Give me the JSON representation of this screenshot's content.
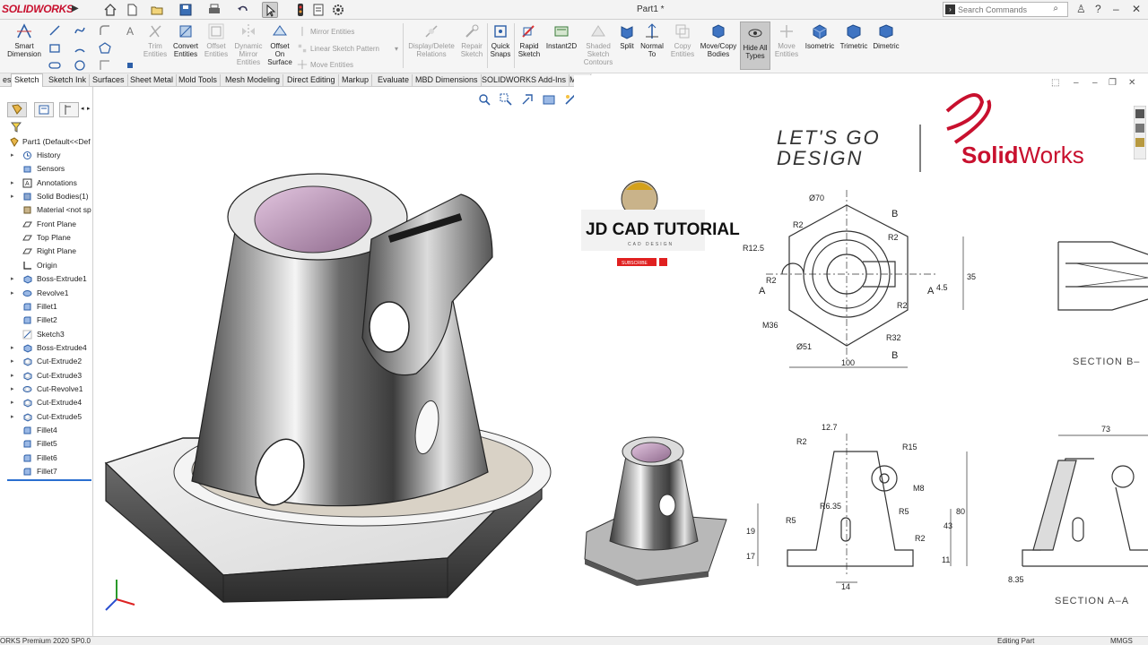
{
  "app": {
    "logo": "SOLIDWORKS",
    "document_title": "Part1 *"
  },
  "search": {
    "placeholder": "Search Commands"
  },
  "command_manager": {
    "items": [
      {
        "label": "Smart Dimension",
        "enabled": true,
        "icon": "smart-dimension-icon"
      },
      {
        "label": "Trim Entities",
        "enabled": false,
        "icon": "trim-icon"
      },
      {
        "label": "Convert Entities",
        "enabled": true,
        "icon": "convert-entities-icon"
      },
      {
        "label": "Offset Entities",
        "enabled": false,
        "icon": "offset-icon"
      },
      {
        "label": "Dynamic Mirror Entities",
        "enabled": false,
        "icon": "dynamic-mirror-icon"
      },
      {
        "label": "Offset On Surface",
        "enabled": true,
        "icon": "offset-surface-icon"
      },
      {
        "label": "Display/Delete Relations",
        "enabled": false,
        "icon": "relations-icon"
      },
      {
        "label": "Repair Sketch",
        "enabled": false,
        "icon": "repair-sketch-icon"
      },
      {
        "label": "Quick Snaps",
        "enabled": true,
        "icon": "quick-snaps-icon"
      },
      {
        "label": "Rapid Sketch",
        "enabled": true,
        "icon": "rapid-sketch-icon"
      },
      {
        "label": "Instant2D",
        "enabled": true,
        "icon": "instant2d-icon"
      },
      {
        "label": "Shaded Sketch Contours",
        "enabled": false,
        "icon": "shaded-sketch-icon"
      },
      {
        "label": "Split",
        "enabled": true,
        "icon": "split-icon"
      },
      {
        "label": "Normal To",
        "enabled": true,
        "icon": "normal-to-icon"
      },
      {
        "label": "Copy Entities",
        "enabled": false,
        "icon": "copy-entities-icon"
      },
      {
        "label": "Move/Copy Bodies",
        "enabled": true,
        "icon": "move-copy-icon"
      },
      {
        "label": "Hide All Types",
        "enabled": true,
        "icon": "hide-all-types-icon"
      },
      {
        "label": "Move Entities",
        "enabled": false,
        "icon": "move-entities-icon"
      },
      {
        "label": "Isometric",
        "enabled": true,
        "icon": "isometric-icon"
      },
      {
        "label": "Trimetric",
        "enabled": true,
        "icon": "trimetric-icon"
      },
      {
        "label": "Dimetric",
        "enabled": true,
        "icon": "dimetric-icon"
      }
    ],
    "small_items": {
      "mirror": "Mirror Entities",
      "linear_pattern": "Linear Sketch Pattern",
      "move": "Move Entities"
    }
  },
  "tabs": [
    "Features",
    "Sketch",
    "Sketch Ink",
    "Surfaces",
    "Sheet Metal",
    "Mold Tools",
    "Mesh Modeling",
    "Direct Editing",
    "Markup",
    "Evaluate",
    "MBD Dimensions",
    "SOLIDWORKS Add-Ins",
    "MBD"
  ],
  "tabs_visible": [
    "es",
    "Sketch",
    "Sketch Ink",
    "Surfaces",
    "Sheet Metal",
    "Mold Tools",
    "Mesh Modeling",
    "Direct Editing",
    "Markup",
    "Evaluate",
    "MBD Dimensions",
    "SOLIDWORKS Add-Ins",
    "MBD"
  ],
  "active_tab": "Sketch",
  "feature_tree": {
    "root": "Part1  (Default<<Def",
    "nodes": [
      {
        "label": "History",
        "expand": true,
        "icon": "history-icon"
      },
      {
        "label": "Sensors",
        "expand": false,
        "icon": "sensor-icon"
      },
      {
        "label": "Annotations",
        "expand": true,
        "icon": "annotation-icon"
      },
      {
        "label": "Solid Bodies(1)",
        "expand": true,
        "icon": "solid-bodies-icon"
      },
      {
        "label": "Material <not sp",
        "expand": false,
        "icon": "material-icon"
      },
      {
        "label": "Front Plane",
        "expand": false,
        "icon": "plane-icon"
      },
      {
        "label": "Top Plane",
        "expand": false,
        "icon": "plane-icon"
      },
      {
        "label": "Right Plane",
        "expand": false,
        "icon": "plane-icon"
      },
      {
        "label": "Origin",
        "expand": false,
        "icon": "origin-icon"
      },
      {
        "label": "Boss-Extrude1",
        "expand": true,
        "icon": "extrude-icon"
      },
      {
        "label": "Revolve1",
        "expand": true,
        "icon": "revolve-icon"
      },
      {
        "label": "Fillet1",
        "expand": false,
        "icon": "fillet-icon"
      },
      {
        "label": "Fillet2",
        "expand": false,
        "icon": "fillet-icon"
      },
      {
        "label": "Sketch3",
        "expand": false,
        "icon": "sketch-icon"
      },
      {
        "label": "Boss-Extrude4",
        "expand": true,
        "icon": "extrude-icon"
      },
      {
        "label": "Cut-Extrude2",
        "expand": true,
        "icon": "cut-extrude-icon"
      },
      {
        "label": "Cut-Extrude3",
        "expand": true,
        "icon": "cut-extrude-icon"
      },
      {
        "label": "Cut-Revolve1",
        "expand": true,
        "icon": "cut-revolve-icon"
      },
      {
        "label": "Cut-Extrude4",
        "expand": true,
        "icon": "cut-extrude-icon"
      },
      {
        "label": "Cut-Extrude5",
        "expand": true,
        "icon": "cut-extrude-icon"
      },
      {
        "label": "Fillet4",
        "expand": false,
        "icon": "fillet-icon"
      },
      {
        "label": "Fillet5",
        "expand": false,
        "icon": "fillet-icon"
      },
      {
        "label": "Fillet6",
        "expand": false,
        "icon": "fillet-icon"
      },
      {
        "label": "Fillet7",
        "expand": false,
        "icon": "fillet-icon"
      }
    ]
  },
  "overlay": {
    "tagline_line1": "LET'S GO",
    "tagline_line2": "DESIGN",
    "brand": "SolidWorks",
    "brand_parts": {
      "a": "Solid",
      "b": "Works"
    },
    "channel": "JD CAD TUTORIAL",
    "channel_sub": "CAD DESIGN",
    "subscribe": "SUBSCRIBE"
  },
  "drawing": {
    "top_view": {
      "labels": [
        "R2",
        "R12.5",
        "R2",
        "R2",
        "M36",
        "Ø70",
        "R2",
        "Ø51",
        "R32",
        "35",
        "4.5",
        "100",
        "B",
        "B",
        "A",
        "A"
      ]
    },
    "section_b": "SECTION B–",
    "front_view": {
      "labels": [
        "12.7",
        "R2",
        "R15",
        "M8",
        "R6.35",
        "R5",
        "R2",
        "43",
        "R5",
        "19",
        "17",
        "14",
        "80",
        "11"
      ]
    },
    "section_a": "SECTION A–A",
    "section_a_labels": [
      "73",
      "8.35"
    ]
  },
  "status": {
    "left": "ORKS Premium 2020 SP0.0",
    "mode": "Editing Part",
    "units": "MMGS"
  },
  "colors": {
    "brand_red": "#c8102e",
    "accent_blue": "#2a6fd0",
    "metal_dark": "#4a4a4a",
    "bore_pink": "#c9a6c9"
  }
}
